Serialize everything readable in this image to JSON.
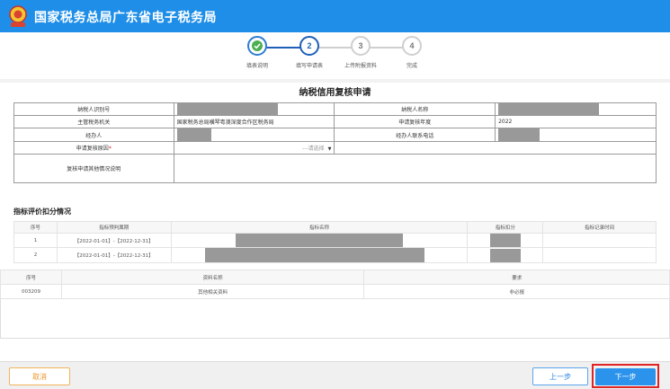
{
  "header": {
    "title": "国家税务总局广东省电子税务局",
    "bar_color": "#1e8ee8"
  },
  "steps": [
    {
      "number": "",
      "label": "填表说明",
      "state": "done"
    },
    {
      "number": "2",
      "label": "填写申请表",
      "state": "active"
    },
    {
      "number": "3",
      "label": "上传附报资料",
      "state": "pending"
    },
    {
      "number": "4",
      "label": "完成",
      "state": "pending"
    }
  ],
  "form": {
    "title": "纳税信用复核申请",
    "taxpayer_id_label": "纳税人识别号",
    "taxpayer_name_label": "纳税人名称",
    "tax_authority_label": "主管税务机关",
    "tax_authority_value": "国家税务总局横琴粤澳深度合作区税务局",
    "review_year_label": "申请复核年度",
    "review_year_value": "2022",
    "agent_label": "经办人",
    "agent_phone_label": "经办人联系电话",
    "reason_label": "申请复核原因",
    "reason_required_mark": "*",
    "reason_placeholder": "---请选择",
    "other_label": "复核申请其他情况说明"
  },
  "deduction": {
    "title": "指标评价扣分情况",
    "columns": [
      "序号",
      "指标预判属期",
      "指标名称",
      "指标扣分",
      "指标记录时间"
    ],
    "rows": [
      {
        "index": "1",
        "period": "【2022-01-01】-【2022-12-31】"
      },
      {
        "index": "2",
        "period": "【2022-01-01】-【2022-12-31】"
      }
    ]
  },
  "materials": {
    "columns": [
      "序号",
      "资料名称",
      "要求"
    ],
    "rows": [
      {
        "index": "003209",
        "name": "其他相关资料",
        "requirement": "非必报"
      }
    ]
  },
  "footer": {
    "cancel_label": "取消",
    "prev_label": "上一步",
    "next_label": "下一步"
  }
}
